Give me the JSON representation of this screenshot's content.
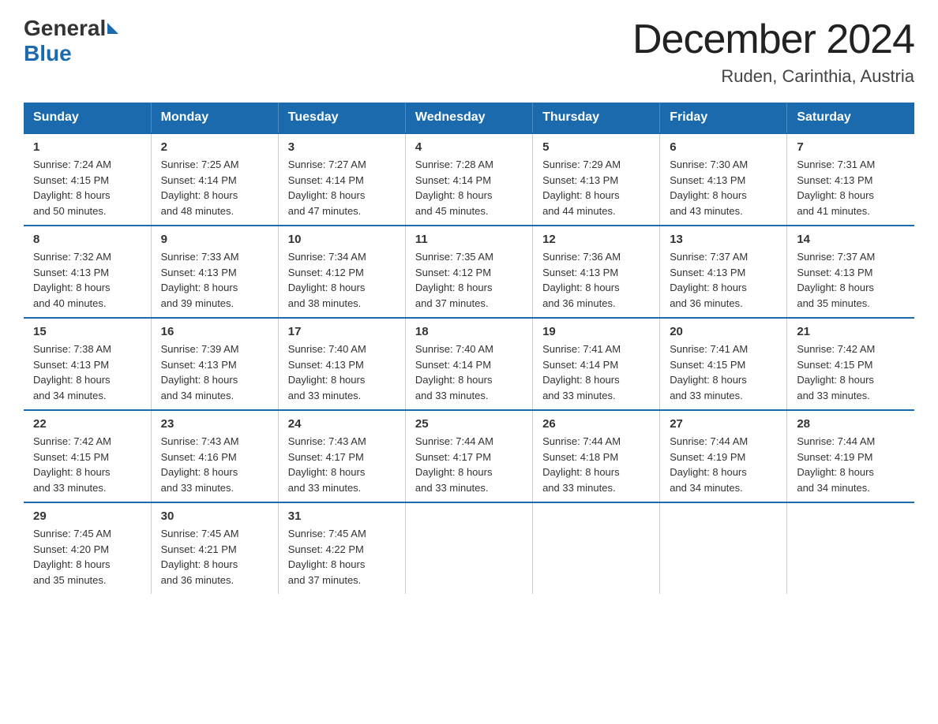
{
  "header": {
    "logo": {
      "general": "General",
      "blue": "Blue"
    },
    "title": "December 2024",
    "subtitle": "Ruden, Carinthia, Austria"
  },
  "days_of_week": [
    "Sunday",
    "Monday",
    "Tuesday",
    "Wednesday",
    "Thursday",
    "Friday",
    "Saturday"
  ],
  "weeks": [
    [
      {
        "day": "1",
        "sunrise": "7:24 AM",
        "sunset": "4:15 PM",
        "daylight": "8 hours and 50 minutes."
      },
      {
        "day": "2",
        "sunrise": "7:25 AM",
        "sunset": "4:14 PM",
        "daylight": "8 hours and 48 minutes."
      },
      {
        "day": "3",
        "sunrise": "7:27 AM",
        "sunset": "4:14 PM",
        "daylight": "8 hours and 47 minutes."
      },
      {
        "day": "4",
        "sunrise": "7:28 AM",
        "sunset": "4:14 PM",
        "daylight": "8 hours and 45 minutes."
      },
      {
        "day": "5",
        "sunrise": "7:29 AM",
        "sunset": "4:13 PM",
        "daylight": "8 hours and 44 minutes."
      },
      {
        "day": "6",
        "sunrise": "7:30 AM",
        "sunset": "4:13 PM",
        "daylight": "8 hours and 43 minutes."
      },
      {
        "day": "7",
        "sunrise": "7:31 AM",
        "sunset": "4:13 PM",
        "daylight": "8 hours and 41 minutes."
      }
    ],
    [
      {
        "day": "8",
        "sunrise": "7:32 AM",
        "sunset": "4:13 PM",
        "daylight": "8 hours and 40 minutes."
      },
      {
        "day": "9",
        "sunrise": "7:33 AM",
        "sunset": "4:13 PM",
        "daylight": "8 hours and 39 minutes."
      },
      {
        "day": "10",
        "sunrise": "7:34 AM",
        "sunset": "4:12 PM",
        "daylight": "8 hours and 38 minutes."
      },
      {
        "day": "11",
        "sunrise": "7:35 AM",
        "sunset": "4:12 PM",
        "daylight": "8 hours and 37 minutes."
      },
      {
        "day": "12",
        "sunrise": "7:36 AM",
        "sunset": "4:13 PM",
        "daylight": "8 hours and 36 minutes."
      },
      {
        "day": "13",
        "sunrise": "7:37 AM",
        "sunset": "4:13 PM",
        "daylight": "8 hours and 36 minutes."
      },
      {
        "day": "14",
        "sunrise": "7:37 AM",
        "sunset": "4:13 PM",
        "daylight": "8 hours and 35 minutes."
      }
    ],
    [
      {
        "day": "15",
        "sunrise": "7:38 AM",
        "sunset": "4:13 PM",
        "daylight": "8 hours and 34 minutes."
      },
      {
        "day": "16",
        "sunrise": "7:39 AM",
        "sunset": "4:13 PM",
        "daylight": "8 hours and 34 minutes."
      },
      {
        "day": "17",
        "sunrise": "7:40 AM",
        "sunset": "4:13 PM",
        "daylight": "8 hours and 33 minutes."
      },
      {
        "day": "18",
        "sunrise": "7:40 AM",
        "sunset": "4:14 PM",
        "daylight": "8 hours and 33 minutes."
      },
      {
        "day": "19",
        "sunrise": "7:41 AM",
        "sunset": "4:14 PM",
        "daylight": "8 hours and 33 minutes."
      },
      {
        "day": "20",
        "sunrise": "7:41 AM",
        "sunset": "4:15 PM",
        "daylight": "8 hours and 33 minutes."
      },
      {
        "day": "21",
        "sunrise": "7:42 AM",
        "sunset": "4:15 PM",
        "daylight": "8 hours and 33 minutes."
      }
    ],
    [
      {
        "day": "22",
        "sunrise": "7:42 AM",
        "sunset": "4:15 PM",
        "daylight": "8 hours and 33 minutes."
      },
      {
        "day": "23",
        "sunrise": "7:43 AM",
        "sunset": "4:16 PM",
        "daylight": "8 hours and 33 minutes."
      },
      {
        "day": "24",
        "sunrise": "7:43 AM",
        "sunset": "4:17 PM",
        "daylight": "8 hours and 33 minutes."
      },
      {
        "day": "25",
        "sunrise": "7:44 AM",
        "sunset": "4:17 PM",
        "daylight": "8 hours and 33 minutes."
      },
      {
        "day": "26",
        "sunrise": "7:44 AM",
        "sunset": "4:18 PM",
        "daylight": "8 hours and 33 minutes."
      },
      {
        "day": "27",
        "sunrise": "7:44 AM",
        "sunset": "4:19 PM",
        "daylight": "8 hours and 34 minutes."
      },
      {
        "day": "28",
        "sunrise": "7:44 AM",
        "sunset": "4:19 PM",
        "daylight": "8 hours and 34 minutes."
      }
    ],
    [
      {
        "day": "29",
        "sunrise": "7:45 AM",
        "sunset": "4:20 PM",
        "daylight": "8 hours and 35 minutes."
      },
      {
        "day": "30",
        "sunrise": "7:45 AM",
        "sunset": "4:21 PM",
        "daylight": "8 hours and 36 minutes."
      },
      {
        "day": "31",
        "sunrise": "7:45 AM",
        "sunset": "4:22 PM",
        "daylight": "8 hours and 37 minutes."
      },
      null,
      null,
      null,
      null
    ]
  ],
  "labels": {
    "sunrise": "Sunrise:",
    "sunset": "Sunset:",
    "daylight": "Daylight:"
  }
}
